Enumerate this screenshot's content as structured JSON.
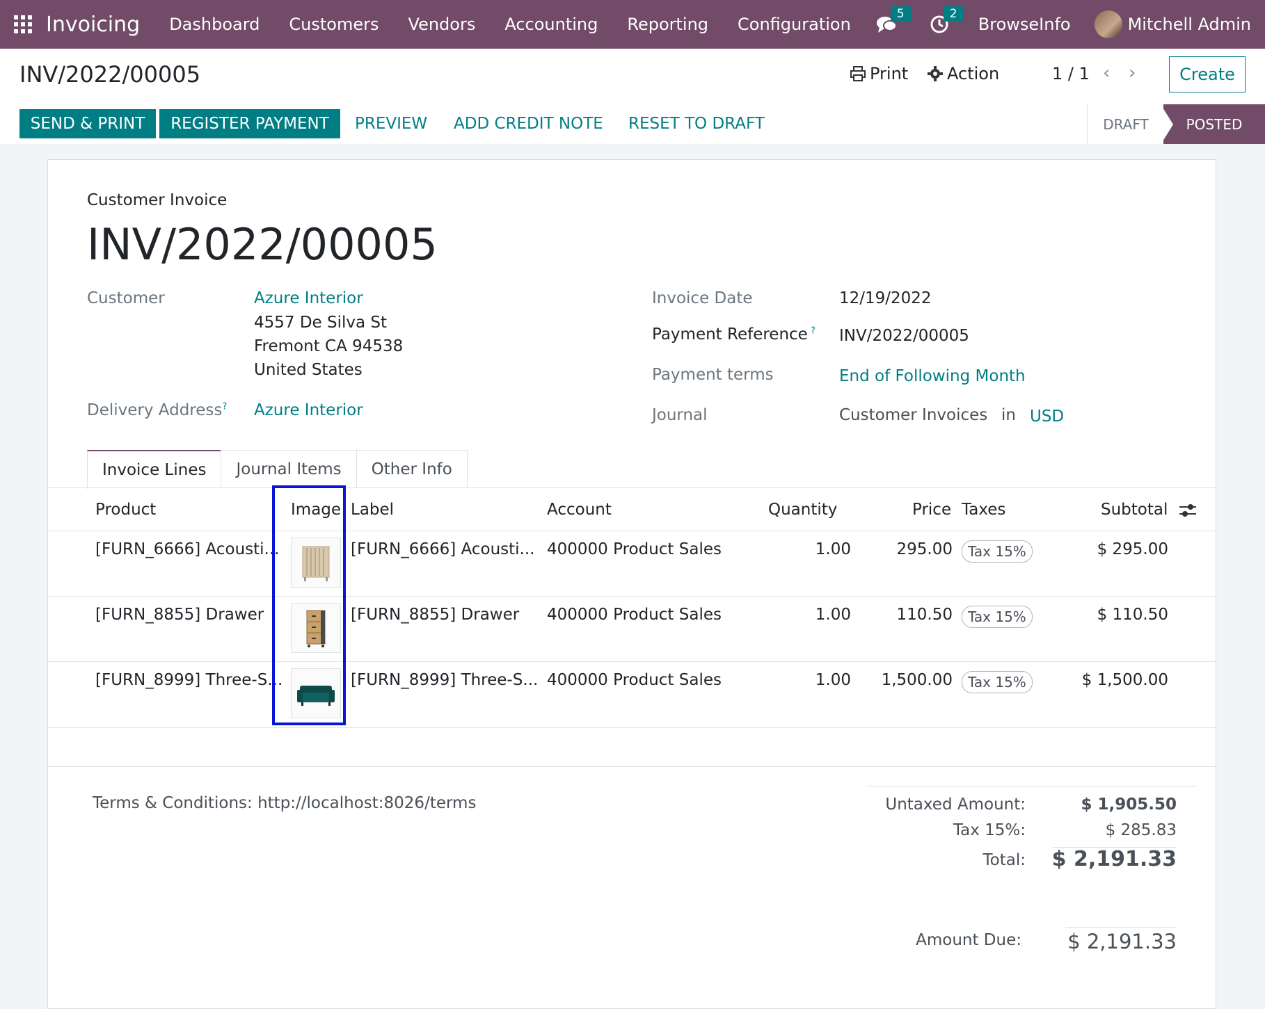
{
  "nav": {
    "app_name": "Invoicing",
    "menu": [
      "Dashboard",
      "Customers",
      "Vendors",
      "Accounting",
      "Reporting",
      "Configuration"
    ],
    "messages_count": "5",
    "activities_count": "2",
    "company": "BrowseInfo",
    "user": "Mitchell Admin"
  },
  "control": {
    "breadcrumb": "INV/2022/00005",
    "print": "Print",
    "action": "Action",
    "pager": "1 / 1",
    "create": "Create"
  },
  "status": {
    "buttons": [
      "SEND & PRINT",
      "REGISTER PAYMENT"
    ],
    "links": [
      "PREVIEW",
      "ADD CREDIT NOTE",
      "RESET TO DRAFT"
    ],
    "stages": [
      "DRAFT",
      "POSTED"
    ],
    "current_stage": "POSTED"
  },
  "invoice": {
    "type": "Customer Invoice",
    "number": "INV/2022/00005",
    "customer_label": "Customer",
    "customer_name": "Azure Interior",
    "address": [
      "4557 De Silva St",
      "Fremont CA 94538",
      "United States"
    ],
    "delivery_label": "Delivery Address",
    "delivery_value": "Azure Interior",
    "invoice_date_label": "Invoice Date",
    "invoice_date": "12/19/2022",
    "payment_ref_label": "Payment Reference",
    "payment_ref": "INV/2022/00005",
    "payment_terms_label": "Payment terms",
    "payment_terms": "End of Following Month",
    "journal_label": "Journal",
    "journal": "Customer Invoices",
    "journal_in": "in",
    "currency": "USD"
  },
  "tabs": [
    "Invoice Lines",
    "Journal Items",
    "Other Info"
  ],
  "table": {
    "headers": [
      "Product",
      "Image",
      "Label",
      "Account",
      "Quantity",
      "Price",
      "Taxes",
      "Subtotal"
    ],
    "rows": [
      {
        "product": "[FURN_6666] Acousti...",
        "label": "[FURN_6666] Acousti...",
        "account": "400000 Product Sales",
        "quantity": "1.00",
        "price": "295.00",
        "tax": "Tax 15%",
        "subtotal": "$ 295.00",
        "image_icon": "acoustic-panel-image"
      },
      {
        "product": "[FURN_8855] Drawer",
        "label": "[FURN_8855] Drawer",
        "account": "400000 Product Sales",
        "quantity": "1.00",
        "price": "110.50",
        "tax": "Tax 15%",
        "subtotal": "$ 110.50",
        "image_icon": "drawer-image"
      },
      {
        "product": "[FURN_8999] Three-S...",
        "label": "[FURN_8999] Three-S...",
        "account": "400000 Product Sales",
        "quantity": "1.00",
        "price": "1,500.00",
        "tax": "Tax 15%",
        "subtotal": "$ 1,500.00",
        "image_icon": "sofa-image"
      }
    ]
  },
  "footer": {
    "terms": "Terms & Conditions: http://localhost:8026/terms",
    "untaxed_label": "Untaxed Amount:",
    "untaxed_value": "$ 1,905.50",
    "tax_label": "Tax 15%:",
    "tax_value": "$ 285.83",
    "total_label": "Total:",
    "total_value": "$ 2,191.33",
    "due_label": "Amount Due:",
    "due_value": "$ 2,191.33"
  },
  "colors": {
    "brand": "#714b67",
    "accent": "#017e84",
    "highlight": "#0a14d6"
  }
}
